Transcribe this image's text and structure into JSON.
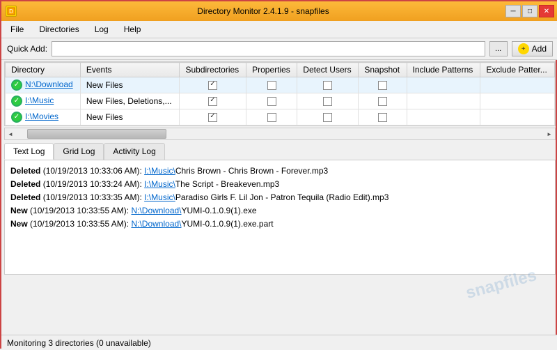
{
  "titleBar": {
    "title": "Directory Monitor 2.4.1.9 - snapfiles",
    "minimizeLabel": "─",
    "maximizeLabel": "□",
    "closeLabel": "✕"
  },
  "menuBar": {
    "items": [
      "File",
      "Directories",
      "Log",
      "Help"
    ]
  },
  "quickAdd": {
    "label": "Quick Add:",
    "inputValue": "",
    "inputPlaceholder": "",
    "browseLabel": "...",
    "addLabel": "Add"
  },
  "tableHeaders": [
    "Directory",
    "Events",
    "Subdirectories",
    "Properties",
    "Detect Users",
    "Snapshot",
    "Include Patterns",
    "Exclude Patterns"
  ],
  "tableRows": [
    {
      "directory": "N:\\Download",
      "events": "New Files",
      "subdirectories": true,
      "properties": false,
      "detectUsers": false,
      "snapshot": false
    },
    {
      "directory": "I:\\Music",
      "events": "New Files, Deletions,...",
      "subdirectories": true,
      "properties": false,
      "detectUsers": false,
      "snapshot": false
    },
    {
      "directory": "I:\\Movies",
      "events": "New Files",
      "subdirectories": true,
      "properties": false,
      "detectUsers": false,
      "snapshot": false
    }
  ],
  "tabs": [
    "Text Log",
    "Grid Log",
    "Activity Log"
  ],
  "activeTab": "Text Log",
  "logEntries": [
    {
      "type": "Deleted",
      "timestamp": "(10/19/2013 10:33:06 AM):",
      "pathPrefix": "I:\\Music\\",
      "pathSuffix": "Chris Brown - Chris Brown - Forever.mp3",
      "prefixLink": "I:\\Music\\"
    },
    {
      "type": "Deleted",
      "timestamp": "(10/19/2013 10:33:24 AM):",
      "pathPrefix": "I:\\Music\\",
      "pathSuffix": "The Script - Breakeven.mp3",
      "prefixLink": "I:\\Music\\"
    },
    {
      "type": "Deleted",
      "timestamp": "(10/19/2013 10:33:35 AM):",
      "pathPrefix": "I:\\Music\\",
      "pathSuffix": "Paradiso Girls F. Lil Jon - Patron Tequila (Radio Edit).mp3",
      "prefixLink": "I:\\Music\\"
    },
    {
      "type": "New",
      "timestamp": "(10/19/2013 10:33:55 AM):",
      "pathPrefix": "N:\\Download\\",
      "pathSuffix": "YUMI-0.1.0.9(1).exe",
      "prefixLink": "N:\\Download\\"
    },
    {
      "type": "New",
      "timestamp": "(10/19/2013 10:33:55 AM):",
      "pathPrefix": "N:\\Download\\",
      "pathSuffix": "YUMI-0.1.0.9(1).exe.part",
      "prefixLink": "N:\\Download\\"
    }
  ],
  "statusBar": {
    "text": "Monitoring 3 directories (0 unavailable)"
  },
  "watermark": "snapfiles"
}
